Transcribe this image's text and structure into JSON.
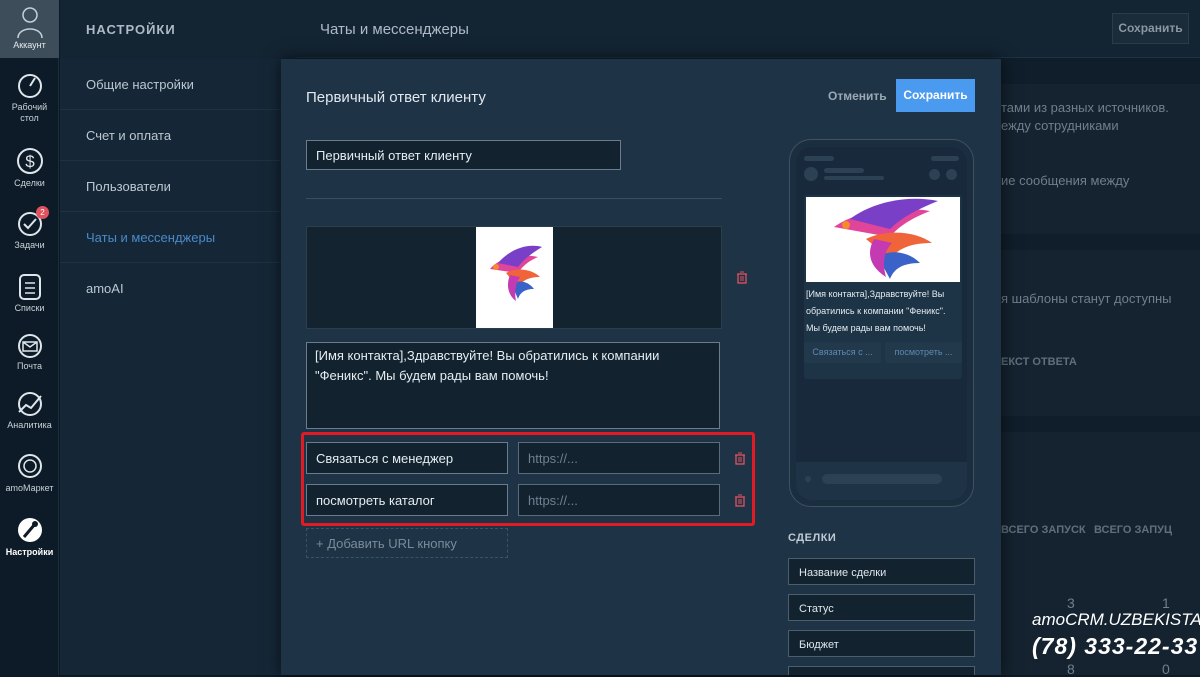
{
  "nav": {
    "account_label": "Аккаунт",
    "items": [
      {
        "label1": "Рабочий",
        "label2": "стол",
        "icon": "dashboard-icon"
      },
      {
        "label1": "Сделки",
        "label2": "",
        "icon": "dollar-icon"
      },
      {
        "label1": "Задачи",
        "label2": "",
        "icon": "check-icon",
        "badge": "2"
      },
      {
        "label1": "Списки",
        "label2": "",
        "icon": "list-icon"
      },
      {
        "label1": "Почта",
        "label2": "",
        "icon": "mail-icon"
      },
      {
        "label1": "Аналитика",
        "label2": "",
        "icon": "chart-icon"
      },
      {
        "label1": "amoМаркет",
        "label2": "",
        "icon": "market-icon"
      },
      {
        "label1": "Настройки",
        "label2": "",
        "icon": "settings-icon"
      }
    ]
  },
  "settings": {
    "header": "НАСТРОЙКИ",
    "items": [
      "Общие настройки",
      "Счет и оплата",
      "Пользователи",
      "Чаты и мессенджеры",
      "amoAI"
    ]
  },
  "main": {
    "title": "Чаты и мессенджеры",
    "save_label": "Сохранить",
    "bg_texts": [
      "тами из разных источников.",
      "ежду сотрудниками",
      "ие сообщения между",
      "я шаблоны станут доступны",
      "ЕКСТ ОТВЕТА",
      "ВСЕГО ЗАПУСК",
      "ВСЕГО ЗАПУЦ",
      "3",
      "1",
      "8",
      "0"
    ]
  },
  "modal": {
    "title": "Первичный ответ клиенту",
    "cancel_label": "Отменить",
    "save_label": "Сохранить",
    "name_value": "Первичный ответ клиенту",
    "message": "[Имя контакта],Здравствуйте! Вы обратились к компании \"Феникс\". Мы будем рады вам помочь!",
    "buttons": [
      {
        "label": "Связаться с менеджер",
        "url_placeholder": "https://..."
      },
      {
        "label": "посмотреть каталог",
        "url_placeholder": "https://..."
      }
    ],
    "add_url_label": "+ Добавить URL кнопку",
    "preview": {
      "text": "[Имя контакта],Здравствуйте! Вы обратились к компании \"Феникс\". Мы будем рады вам помочь!",
      "btn1": "Связаться с ...",
      "btn2": "посмотреть ..."
    },
    "deals": {
      "header": "СДЕЛКИ",
      "fields": [
        "Название сделки",
        "Статус",
        "Бюджет"
      ]
    }
  },
  "watermark": {
    "line1": "amoCRM.UZBEKISTAN",
    "line2": "(78) 333-22-33"
  }
}
